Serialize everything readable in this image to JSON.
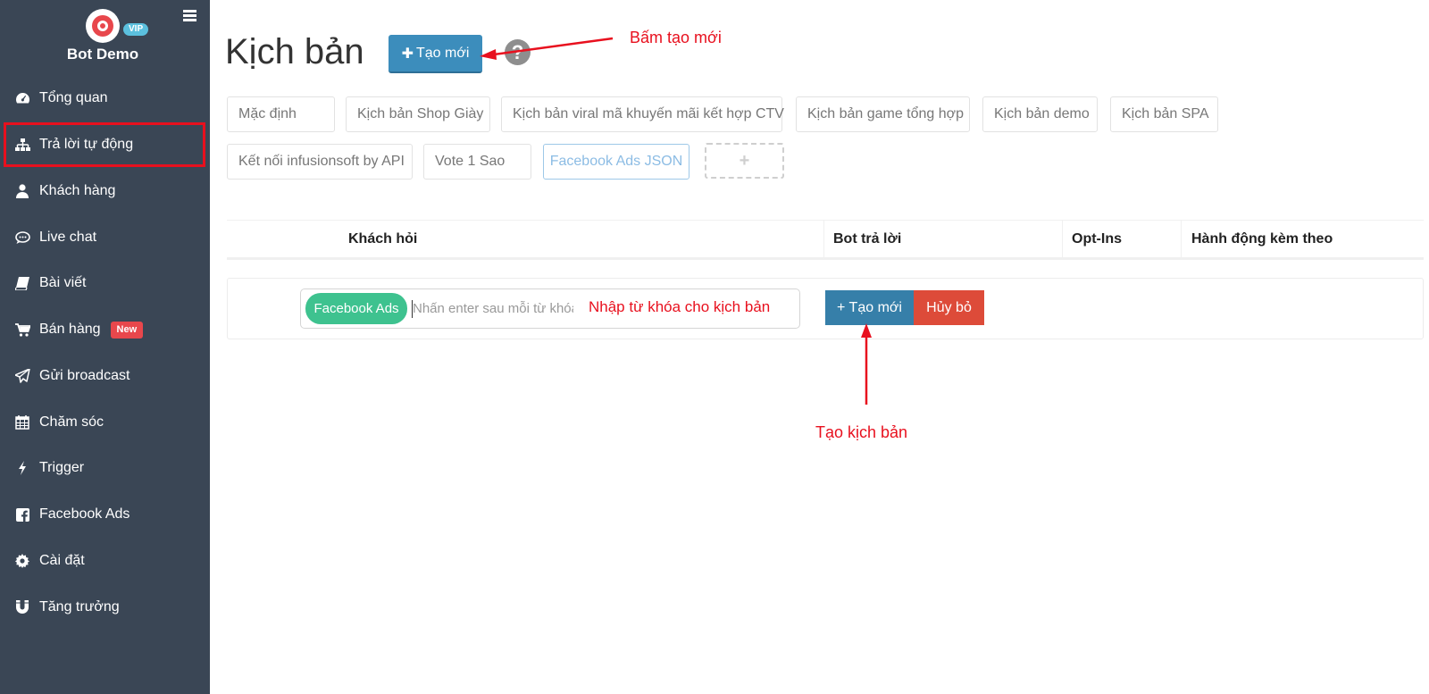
{
  "brand": {
    "name": "Bot Demo",
    "badge": "VIP"
  },
  "sidebar": {
    "items": [
      {
        "label": "Tổng quan",
        "icon": "dashboard-icon"
      },
      {
        "label": "Trả lời tự động",
        "icon": "sitemap-icon",
        "highlighted": true
      },
      {
        "label": "Khách hàng",
        "icon": "user-icon"
      },
      {
        "label": "Live chat",
        "icon": "chat-icon"
      },
      {
        "label": "Bài viết",
        "icon": "book-icon"
      },
      {
        "label": "Bán hàng",
        "icon": "cart-icon",
        "badge": "New"
      },
      {
        "label": "Gửi broadcast",
        "icon": "send-icon"
      },
      {
        "label": "Chăm sóc",
        "icon": "calendar-icon"
      },
      {
        "label": "Trigger",
        "icon": "bolt-icon"
      },
      {
        "label": "Facebook Ads",
        "icon": "facebook-icon"
      },
      {
        "label": "Cài đặt",
        "icon": "gear-icon"
      },
      {
        "label": "Tăng trưởng",
        "icon": "magnet-icon"
      }
    ]
  },
  "header": {
    "title": "Kịch bản",
    "create_label": "Tạo mới"
  },
  "annotations": {
    "top": "Bấm tạo mới",
    "keyword": "Nhập từ khóa cho kịch bản",
    "bottom": "Tạo kịch bản"
  },
  "tabs": [
    "Mặc định",
    "Kịch bản Shop Giày",
    "Kịch bản viral mã khuyến mãi kết hợp CTV",
    "Kịch bản game tổng hợp",
    "Kịch bản demo",
    "Kịch bản SPA",
    "Kết nối infusionsoft by API",
    "Vote 1 Sao",
    "Facebook Ads JSON"
  ],
  "tab_add_symbol": "+",
  "selected_tab": "Facebook Ads JSON",
  "table": {
    "columns": [
      "Khách hỏi",
      "Bot trả lời",
      "Opt-Ins",
      "Hành động kèm theo"
    ]
  },
  "row": {
    "keyword_tag": "Facebook Ads",
    "keyword_placeholder": "Nhấn enter sau mỗi từ khóa",
    "create_label": "+ Tạo mới",
    "cancel_label": "Hủy bỏ"
  },
  "colors": {
    "sidebar_bg": "#3a4655",
    "primary": "#3c8dbc",
    "danger": "#dd4b39",
    "success_tag": "#3ec28f",
    "annotation": "#e8101e",
    "new_badge": "#e8474c"
  }
}
